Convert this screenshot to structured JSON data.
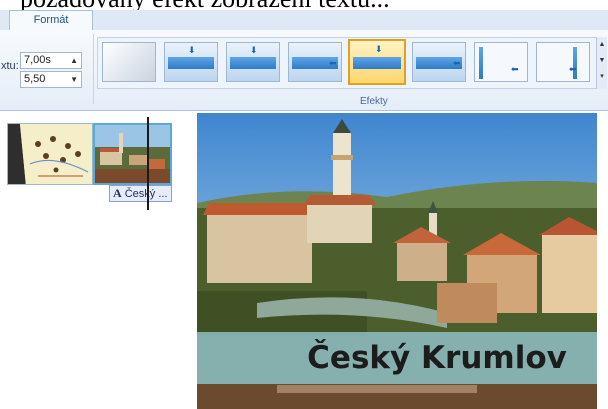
{
  "document": {
    "caption_fragment": "požadovaný efekt zobrazení textu..."
  },
  "ribbon": {
    "active_tab": "Formát",
    "duration_value": "7,00s",
    "option_label": "xtu:",
    "text_size_value": "5,50",
    "effects_group_label": "Efekty",
    "accent_color": "#e0a024"
  },
  "timeline": {
    "caption_clip_icon": "A",
    "caption_clip_label": "Český ..."
  },
  "preview": {
    "title_text": "Český Krumlov"
  }
}
